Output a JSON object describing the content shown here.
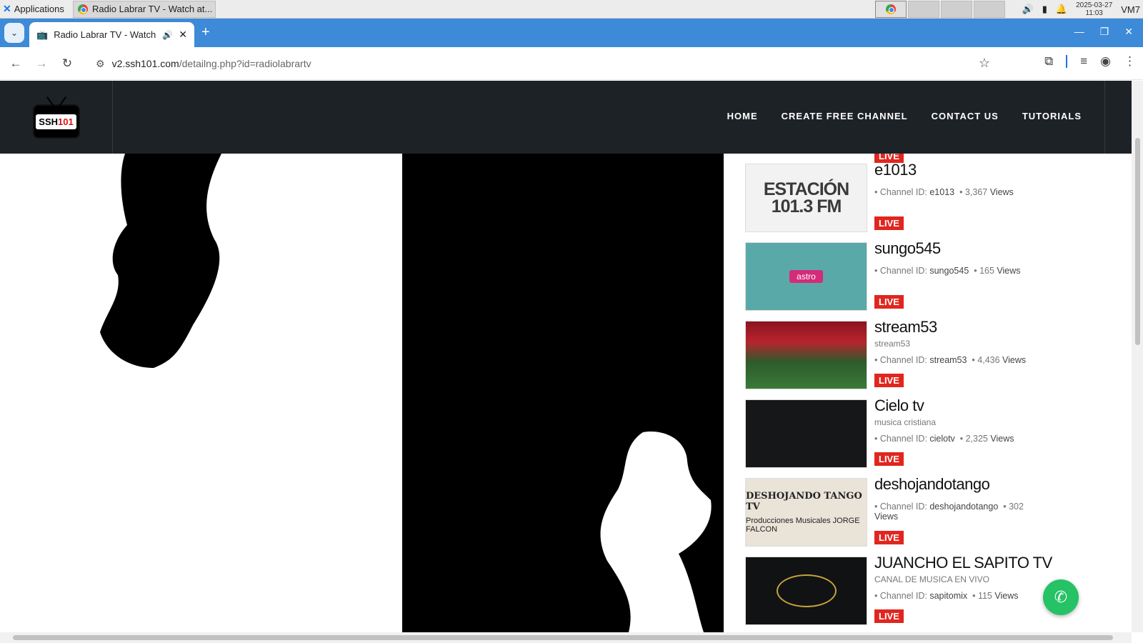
{
  "taskbar": {
    "apps_label": "Applications",
    "window_title": "Radio Labrar TV - Watch at...",
    "date": "2025-03-27",
    "time": "11:03",
    "user": "VM7"
  },
  "browser": {
    "tab_title": "Radio Labrar TV - Watch",
    "url_host": "v2.ssh101.com",
    "url_path": "/detailng.php?id=radiolabrartv"
  },
  "site": {
    "logo_text": "SSH",
    "logo_text_red": "101",
    "nav": [
      "HOME",
      "CREATE FREE CHANNEL",
      "CONTACT US",
      "TUTORIALS"
    ]
  },
  "channels": [
    {
      "name": "",
      "desc": "",
      "channel_id": "",
      "views": "",
      "live": "LIVE"
    },
    {
      "name": "e1013",
      "desc": "",
      "channel_id_label": "Channel ID:",
      "channel_id": "e1013",
      "views": "3,367",
      "views_label": "Views",
      "live": "LIVE",
      "thumb_text": "ESTACIÓN 101.3 FM"
    },
    {
      "name": "sungo545",
      "desc": "",
      "channel_id_label": "Channel ID:",
      "channel_id": "sungo545",
      "views": "165",
      "views_label": "Views",
      "live": "LIVE",
      "thumb_text": "astro"
    },
    {
      "name": "stream53",
      "desc": "stream53",
      "channel_id_label": "Channel ID:",
      "channel_id": "stream53",
      "views": "4,436",
      "views_label": "Views",
      "live": "LIVE"
    },
    {
      "name": "Cielo tv",
      "desc": "musica cristiana",
      "channel_id_label": "Channel ID:",
      "channel_id": "cielotv",
      "views": "2,325",
      "views_label": "Views",
      "live": "LIVE"
    },
    {
      "name": "deshojandotango",
      "desc": "",
      "channel_id_label": "Channel ID:",
      "channel_id": "deshojandotango",
      "views": "302",
      "views_label": "Views",
      "live": "LIVE",
      "thumb_text": "DESHOJANDO TANGO TV",
      "thumb_sub": "Producciones Musicales JORGE FALCON"
    },
    {
      "name": "JUANCHO EL SAPITO TV",
      "desc": "CANAL DE MUSICA EN VIVO",
      "channel_id_label": "Channel ID:",
      "channel_id": "sapitomix",
      "views": "115",
      "views_label": "Views",
      "live": "LIVE"
    }
  ],
  "colors": {
    "header_bg": "#1d2226",
    "live_red": "#e0261f",
    "tab_bar": "#3c8ad8",
    "whatsapp": "#25c266"
  }
}
